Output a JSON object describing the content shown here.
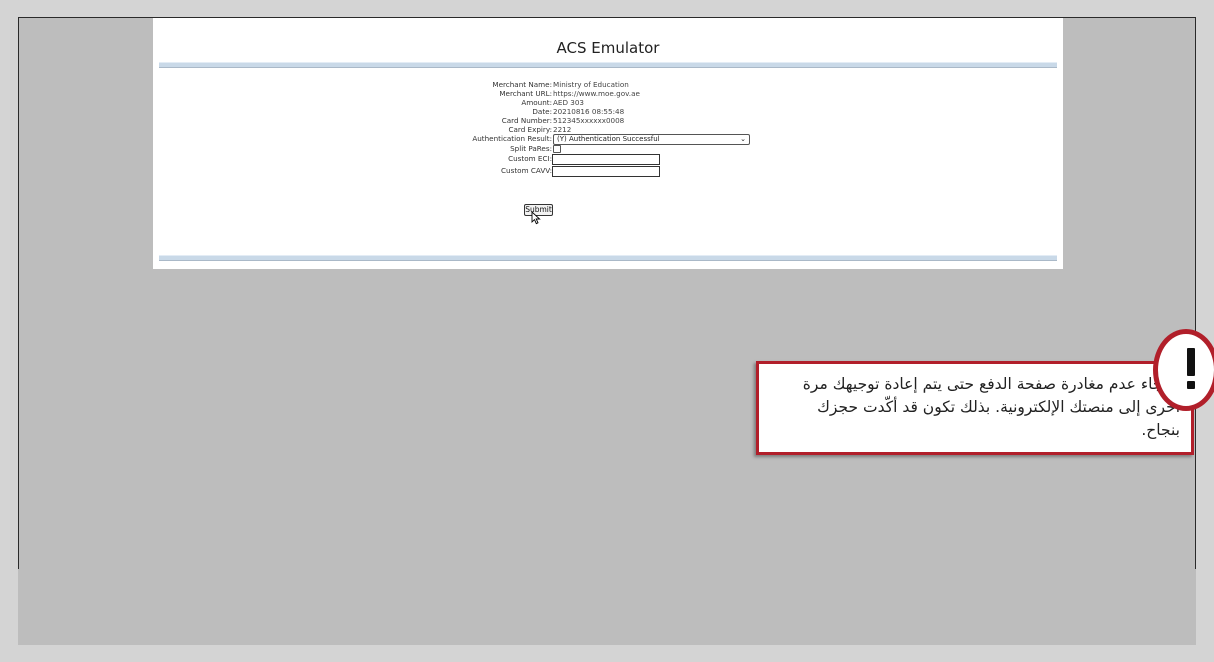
{
  "acs": {
    "title": "ACS Emulator",
    "fields": [
      {
        "label": "Merchant Name:",
        "value": "Ministry of Education"
      },
      {
        "label": "Merchant URL:",
        "value": "https://www.moe.gov.ae"
      },
      {
        "label": "Amount:",
        "value": "AED 303"
      },
      {
        "label": "Date:",
        "value": "20210816 08:55:48"
      },
      {
        "label": "Card Number:",
        "value": "512345xxxxxx0008"
      },
      {
        "label": "Card Expiry:",
        "value": "2212"
      }
    ],
    "authentication_result": {
      "label": "Authentication Result:",
      "selected": "(Y) Authentication Successful",
      "chevron_icon": "chevron-down-icon"
    },
    "split_pares": {
      "label": "Split PaRes:",
      "checked": false
    },
    "custom_eci": {
      "label": "Custom ECI:",
      "value": ""
    },
    "custom_cavv": {
      "label": "Custom CAVV:",
      "value": ""
    },
    "submit_label": "Submit"
  },
  "notice": {
    "text": "الرجاء عدم مغادرة صفحة الدفع حتى يتم إعادة توجيهك مرة أخرى إلى منصتك الإلكترونية. بذلك تكون قد أكّدت حجزك بنجاح.",
    "icon": "exclamation-icon",
    "accent": "#b11f2a"
  }
}
